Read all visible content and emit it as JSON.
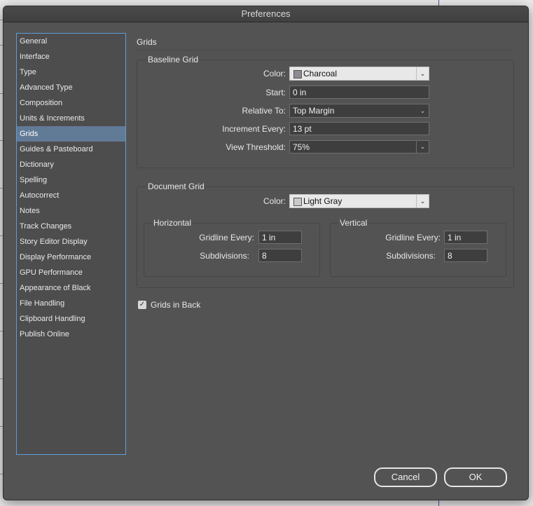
{
  "window": {
    "title": "Preferences"
  },
  "sidebar": {
    "items": [
      {
        "label": "General"
      },
      {
        "label": "Interface"
      },
      {
        "label": "Type"
      },
      {
        "label": "Advanced Type"
      },
      {
        "label": "Composition"
      },
      {
        "label": "Units & Increments"
      },
      {
        "label": "Grids",
        "selected": true
      },
      {
        "label": "Guides & Pasteboard"
      },
      {
        "label": "Dictionary"
      },
      {
        "label": "Spelling"
      },
      {
        "label": "Autocorrect"
      },
      {
        "label": "Notes"
      },
      {
        "label": "Track Changes"
      },
      {
        "label": "Story Editor Display"
      },
      {
        "label": "Display Performance"
      },
      {
        "label": "GPU Performance"
      },
      {
        "label": "Appearance of Black"
      },
      {
        "label": "File Handling"
      },
      {
        "label": "Clipboard Handling"
      },
      {
        "label": "Publish Online"
      }
    ]
  },
  "main": {
    "heading": "Grids",
    "baseline": {
      "title": "Baseline Grid",
      "color_label": "Color:",
      "color_value": "Charcoal",
      "color_swatch": "#8f8a93",
      "start_label": "Start:",
      "start_value": "0 in",
      "relative_label": "Relative To:",
      "relative_value": "Top Margin",
      "increment_label": "Increment Every:",
      "increment_value": "13 pt",
      "threshold_label": "View Threshold:",
      "threshold_value": "75%"
    },
    "document": {
      "title": "Document Grid",
      "color_label": "Color:",
      "color_value": "Light Gray",
      "color_swatch": "#c9c9c9",
      "horizontal": {
        "title": "Horizontal",
        "gridline_label": "Gridline Every:",
        "gridline_value": "1 in",
        "subdiv_label": "Subdivisions:",
        "subdiv_value": "8"
      },
      "vertical": {
        "title": "Vertical",
        "gridline_label": "Gridline Every:",
        "gridline_value": "1 in",
        "subdiv_label": "Subdivisions:",
        "subdiv_value": "8"
      }
    },
    "grids_in_back": {
      "label": "Grids in Back",
      "checked": true
    }
  },
  "buttons": {
    "cancel": "Cancel",
    "ok": "OK"
  },
  "icons": {
    "chevron": "chevron-down-icon",
    "check": "checkmark-icon"
  }
}
